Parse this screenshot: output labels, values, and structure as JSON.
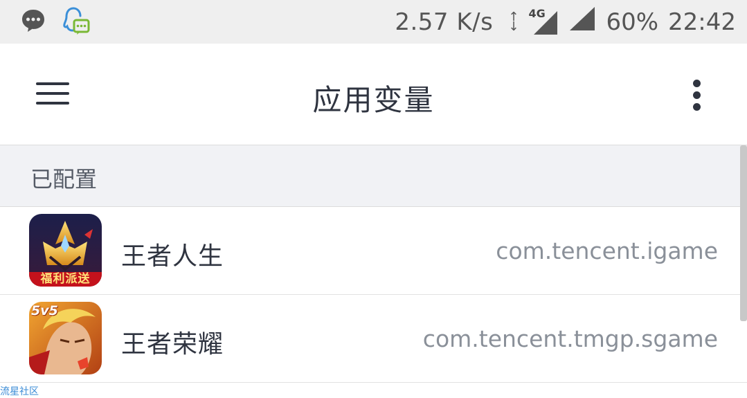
{
  "status_bar": {
    "net_speed": "2.57 K/s",
    "updown_up": "↑",
    "updown_down": "↓",
    "network_type": "4G",
    "battery": "60%",
    "time": "22:42",
    "icons": [
      "chat-bubble-icon",
      "qq-penguin-icon",
      "updown-arrow-icon",
      "network-4g-icon",
      "signal-icon"
    ]
  },
  "app_bar": {
    "title": "应用变量",
    "menu_icon": "hamburger-menu-icon",
    "more_icon": "more-vert-icon"
  },
  "section": {
    "label": "已配置"
  },
  "apps": [
    {
      "name": "王者人生",
      "package": "com.tencent.igame",
      "icon": "wangzhe-rensheng-app-icon",
      "badge_text": "福利派送"
    },
    {
      "name": "王者荣耀",
      "package": "com.tencent.tmgp.sgame",
      "icon": "wangzhe-rongyao-app-icon",
      "badge_text": "5v5"
    }
  ],
  "watermark": "流星社区",
  "colors": {
    "status_bar_bg": "#efefef",
    "section_bg": "#f1f2f5",
    "text_primary": "#2f3440",
    "text_secondary": "#8a9099",
    "watermark": "#3a8bd6"
  }
}
